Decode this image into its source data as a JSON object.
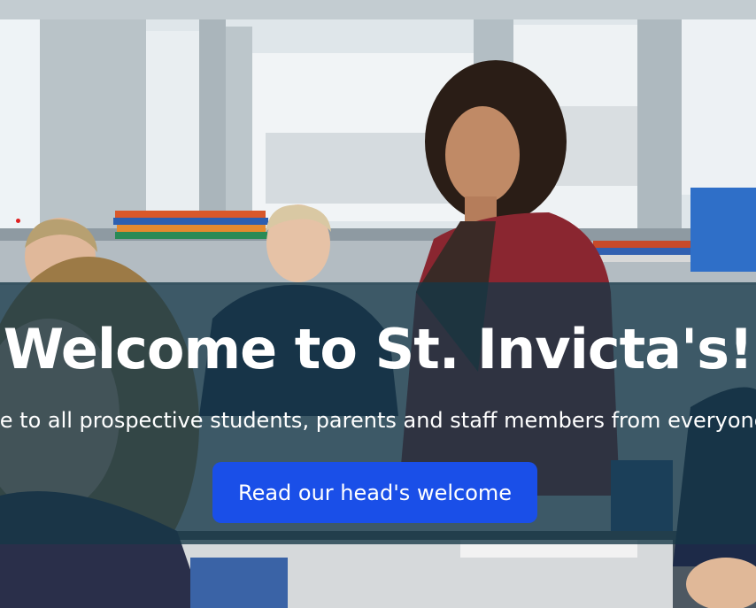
{
  "hero": {
    "title": "Welcome to St. Invicta's!",
    "subtitle": "A warm welcome to all prospective students, parents and staff members from everyone at St. Invicta's",
    "cta_label": "Read our head's welcome"
  },
  "colors": {
    "overlay": "#163746",
    "button": "#1a4fe8",
    "text": "#ffffff"
  }
}
